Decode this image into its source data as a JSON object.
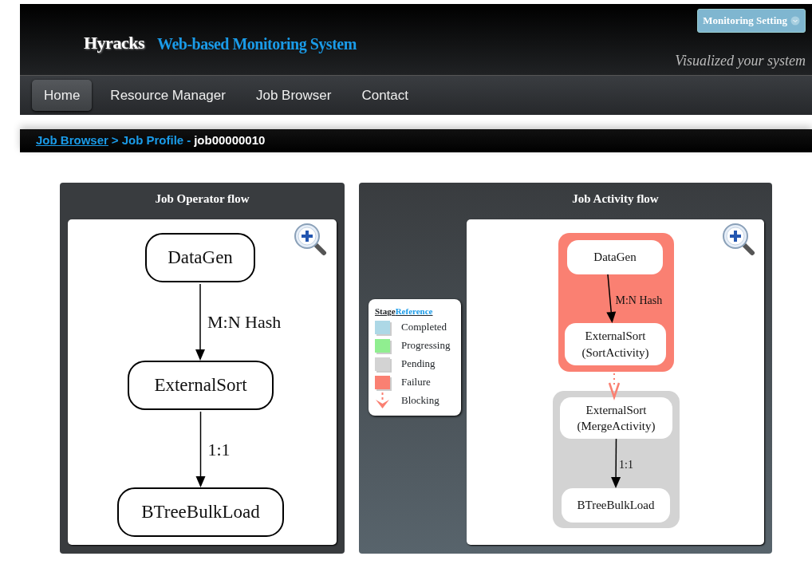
{
  "header": {
    "brand": "Hyracks",
    "subtitle": "Web-based Monitoring System",
    "tagline": "Visualized your system",
    "settings_button": "Monitoring Setting"
  },
  "nav": [
    {
      "label": "Home",
      "selected": true
    },
    {
      "label": "Resource Manager",
      "selected": false
    },
    {
      "label": "Job Browser",
      "selected": false
    },
    {
      "label": "Contact",
      "selected": false
    }
  ],
  "breadcrumb": {
    "links": [
      "Job Browser",
      "Job Profile"
    ],
    "separator": ">",
    "dash": "-",
    "current": "job00000010"
  },
  "operator_flow": {
    "title": "Job Operator flow",
    "nodes": [
      "DataGen",
      "ExternalSort",
      "BTreeBulkLoad"
    ],
    "edges": [
      "M:N Hash",
      "1:1"
    ]
  },
  "activity_flow": {
    "title": "Job Activity flow",
    "legend": {
      "title": "Stage",
      "link": "Reference",
      "items": [
        {
          "kind": "swatch",
          "label": "Completed",
          "color": "#add8e6"
        },
        {
          "kind": "swatch",
          "label": "Progressing",
          "color": "#90ee90"
        },
        {
          "kind": "swatch",
          "label": "Pending",
          "color": "#d3d3d3"
        },
        {
          "kind": "swatch",
          "label": "Failure",
          "color": "#fa8072"
        },
        {
          "kind": "arrow",
          "label": "Blocking",
          "color": "#fa8072"
        }
      ]
    },
    "stages": [
      {
        "color": "#fa8072",
        "blocking": false,
        "nodes": [
          "DataGen",
          "ExternalSort\n(SortActivity)"
        ],
        "edges": [
          "M:N Hash"
        ]
      },
      {
        "color": "#d3d3d3",
        "blocking": true,
        "nodes": [
          "ExternalSort\n(MergeActivity)",
          "BTreeBulkLoad"
        ],
        "edges": [
          "1:1"
        ]
      }
    ]
  }
}
